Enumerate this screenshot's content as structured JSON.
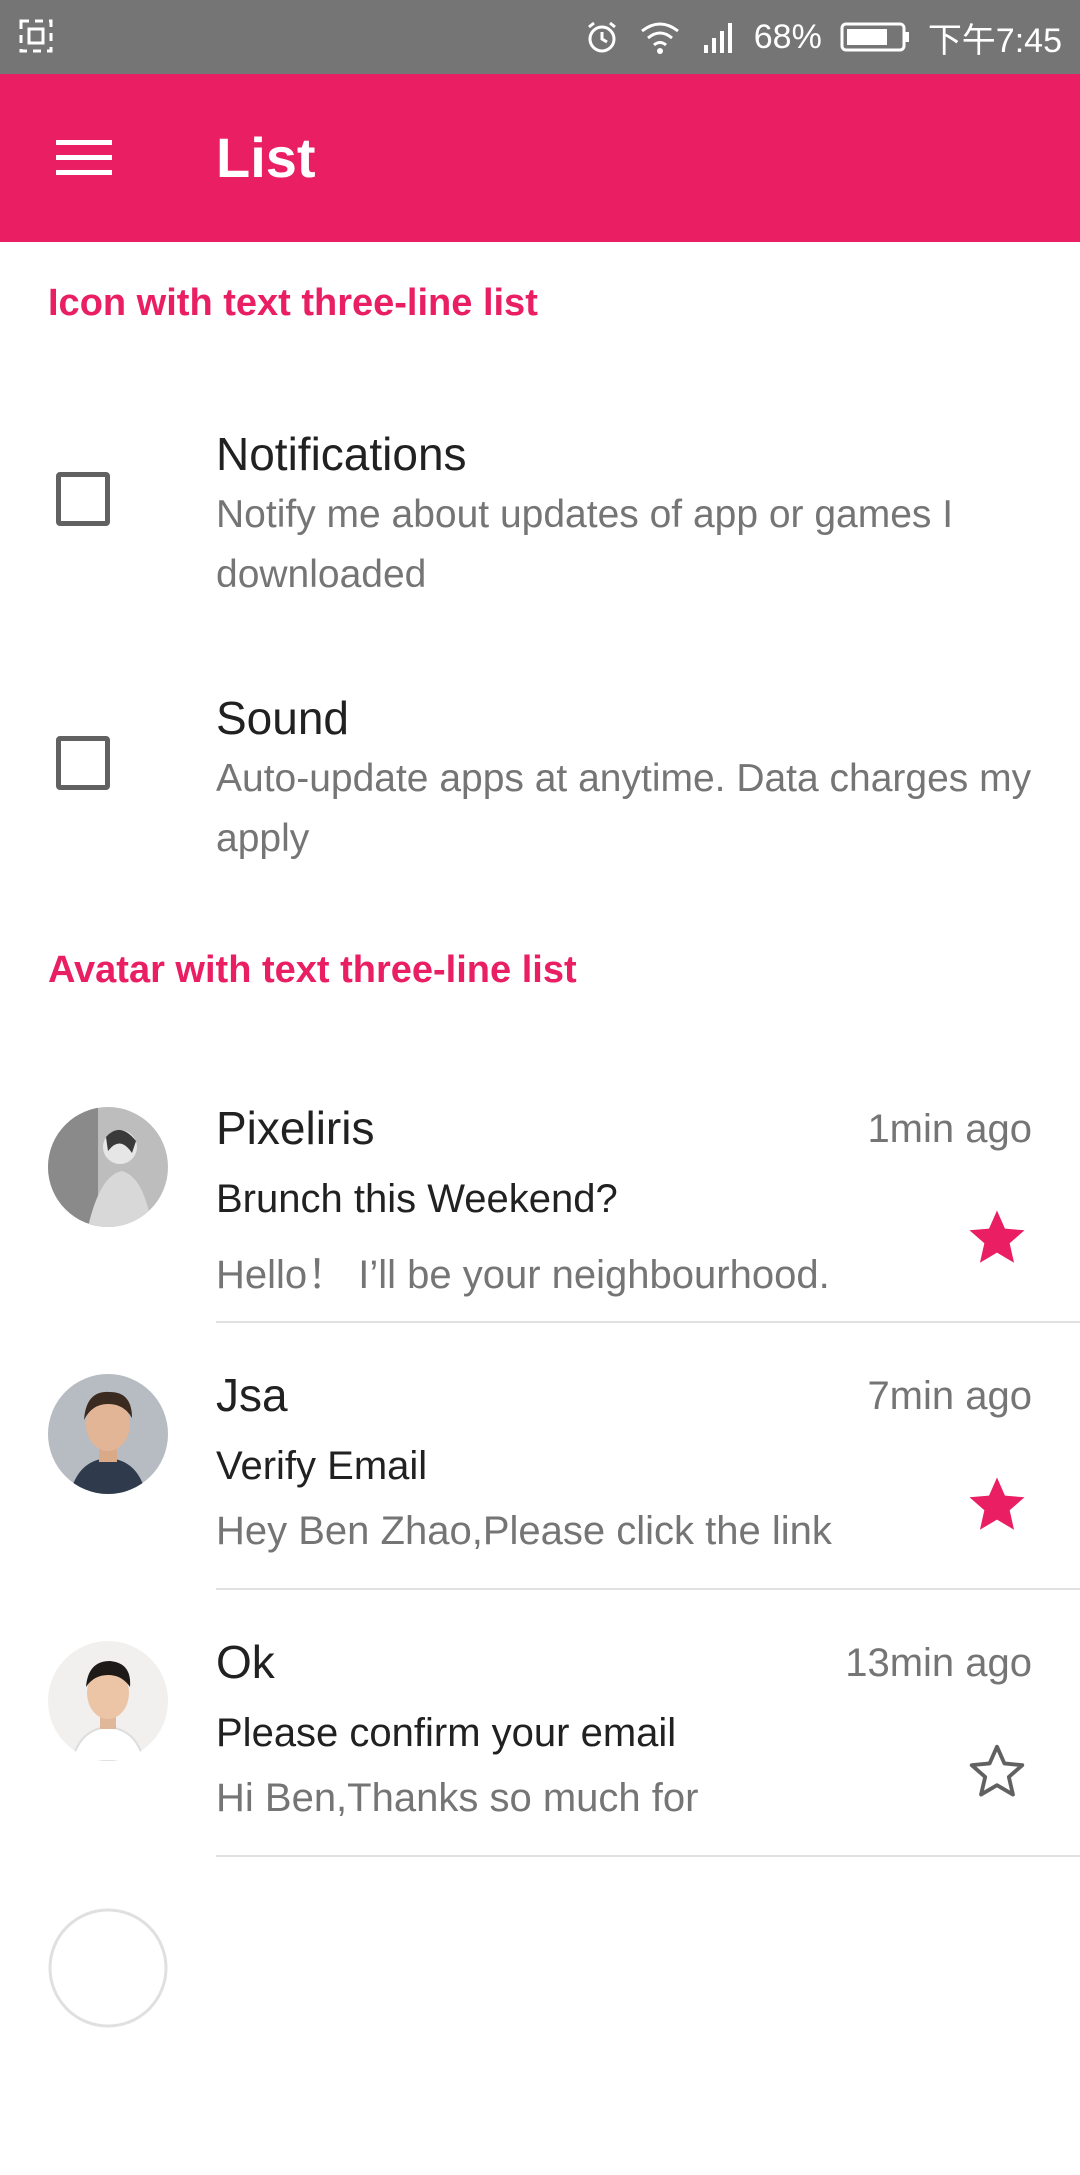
{
  "status_bar": {
    "battery": "68%",
    "time": "下午7:45",
    "icons": [
      "screenshot-icon",
      "alarm-icon",
      "wifi-icon",
      "signal-icon",
      "battery-icon"
    ]
  },
  "app_bar": {
    "title": "List",
    "menu_icon": "hamburger-menu-icon",
    "color": "#e91e63"
  },
  "section1": {
    "header": "Icon with text three-line list",
    "items": [
      {
        "title": "Notifications",
        "subtitle": "Notify me about updates of app or games I downloaded",
        "checked": false
      },
      {
        "title": "Sound",
        "subtitle": "Auto-update apps at anytime. Data charges my apply",
        "checked": false
      }
    ]
  },
  "section2": {
    "header": "Avatar with text three-line list",
    "items": [
      {
        "sender": "Pixeliris",
        "time": "1min ago",
        "subject": "Brunch this Weekend?",
        "preview": "Hello！ I’ll be your neighbourhood.",
        "starred": true
      },
      {
        "sender": "Jsa",
        "time": "7min ago",
        "subject": "Verify Email",
        "preview": "Hey Ben Zhao,Please click the link",
        "starred": true
      },
      {
        "sender": "Ok",
        "time": "13min ago",
        "subject": "Please confirm your email",
        "preview": "Hi Ben,Thanks so much for",
        "starred": false
      }
    ]
  },
  "colors": {
    "accent": "#e91e63",
    "status_bar": "#757575",
    "primary_text": "#212121",
    "secondary_text": "#757575",
    "divider": "#e0e0e0"
  }
}
